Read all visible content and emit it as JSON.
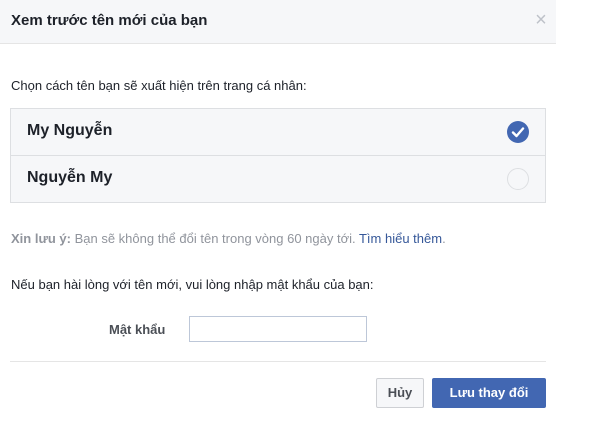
{
  "dialog": {
    "title": "Xem trước tên mới của bạn",
    "close_symbol": "×"
  },
  "prompt": "Chọn cách tên bạn sẽ xuất hiện trên trang cá nhân:",
  "name_options": [
    {
      "label": "My Nguyễn",
      "selected": true
    },
    {
      "label": "Nguyễn My",
      "selected": false
    }
  ],
  "note": {
    "prefix": "Xin lưu ý:",
    "text": " Bạn sẽ không thể đổi tên trong vòng 60 ngày tới. ",
    "link": "Tìm hiểu thêm",
    "suffix": "."
  },
  "confirm_text": "Nếu bạn hài lòng với tên mới, vui lòng nhập mật khẩu của bạn:",
  "password": {
    "label": "Mật khẩu",
    "value": ""
  },
  "buttons": {
    "cancel": "Hủy",
    "save": "Lưu thay đổi"
  },
  "colors": {
    "accent": "#4267b2",
    "link": "#365899",
    "muted": "#90949c"
  },
  "icons": {
    "selected_radio": "check-circle-icon",
    "unselected_radio": "empty-circle-icon",
    "close": "close-icon"
  }
}
